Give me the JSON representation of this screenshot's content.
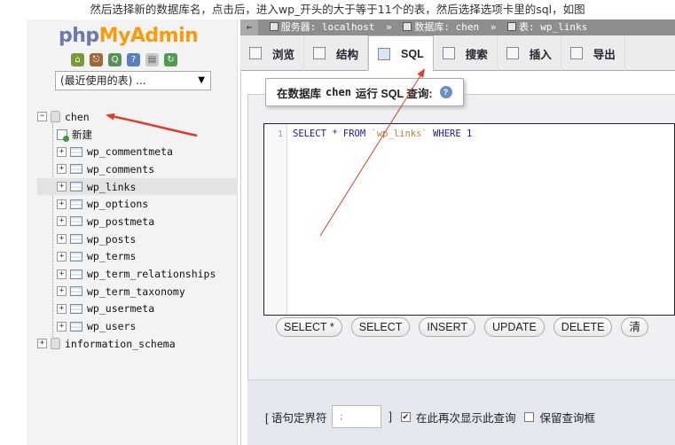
{
  "caption": "然后选择新的数据库名，点击后，进入wp_开头的大于等于11个的表，然后选择选项卡里的sql，如图",
  "nav": {
    "logo_php": "php",
    "logo_my": "My",
    "logo_admin": "Admin",
    "icons": [
      "home-icon",
      "logout-icon",
      "query-icon",
      "help-icon",
      "docs-icon",
      "reload-icon"
    ],
    "recent_select": "(最近使用的表) ...",
    "tree": [
      {
        "kind": "db",
        "expander": "−",
        "label": "chen"
      },
      {
        "kind": "new",
        "label": "新建"
      },
      {
        "kind": "tbl",
        "label": "wp_commentmeta"
      },
      {
        "kind": "tbl",
        "label": "wp_comments"
      },
      {
        "kind": "tbl",
        "label": "wp_links",
        "selected": true
      },
      {
        "kind": "tbl",
        "label": "wp_options"
      },
      {
        "kind": "tbl",
        "label": "wp_postmeta"
      },
      {
        "kind": "tbl",
        "label": "wp_posts"
      },
      {
        "kind": "tbl",
        "label": "wp_terms"
      },
      {
        "kind": "tbl",
        "label": "wp_term_relationships"
      },
      {
        "kind": "tbl",
        "label": "wp_term_taxonomy"
      },
      {
        "kind": "tbl",
        "label": "wp_usermeta"
      },
      {
        "kind": "tbl",
        "label": "wp_users"
      },
      {
        "kind": "db",
        "expander": "+",
        "label": "information_schema"
      }
    ]
  },
  "breadcrumb": {
    "back": "←",
    "server": "服务器: localhost",
    "sep": "»",
    "database": "数据库: chen",
    "table": "表: wp_links"
  },
  "tabs": [
    {
      "label": "浏览",
      "active": false
    },
    {
      "label": "结构",
      "active": false
    },
    {
      "label": "SQL",
      "active": true
    },
    {
      "label": "搜索",
      "active": false
    },
    {
      "label": "插入",
      "active": false
    },
    {
      "label": "导出",
      "active": false
    }
  ],
  "query": {
    "legend_prefix": "在数据库",
    "legend_db": "chen",
    "legend_suffix": "运行 SQL 查询:",
    "line_number": "1",
    "code_kw1": "SELECT * FROM ",
    "code_table": "`wp_links`",
    "code_kw2": " WHERE 1"
  },
  "query_buttons": [
    "SELECT *",
    "SELECT",
    "INSERT",
    "UPDATE",
    "DELETE",
    "清"
  ],
  "footer": {
    "delimiter_label": "[ 语句定界符",
    "delimiter_value": ";",
    "delimiter_close": "]",
    "show_again_label": "在此再次显示此查询",
    "show_again_checked": true,
    "keep_query_label": "保留查询框",
    "keep_query_checked": false
  },
  "colors": {
    "arrow": "#e03a2e",
    "logo_php": "#6c78af",
    "logo_myadmin": "#f89c0e"
  }
}
